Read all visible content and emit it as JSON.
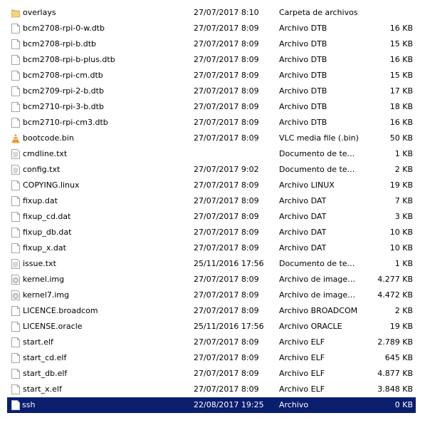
{
  "files": [
    {
      "name": "overlays",
      "date": "27/07/2017 8:10",
      "type": "Carpeta de archivos",
      "size": "",
      "icon": "folder-icon"
    },
    {
      "name": "bcm2708-rpi-0-w.dtb",
      "date": "27/07/2017 8:09",
      "type": "Archivo DTB",
      "size": "16 KB",
      "icon": "file-icon"
    },
    {
      "name": "bcm2708-rpi-b.dtb",
      "date": "27/07/2017 8:09",
      "type": "Archivo DTB",
      "size": "15 KB",
      "icon": "file-icon"
    },
    {
      "name": "bcm2708-rpi-b-plus.dtb",
      "date": "27/07/2017 8:09",
      "type": "Archivo DTB",
      "size": "16 KB",
      "icon": "file-icon"
    },
    {
      "name": "bcm2708-rpi-cm.dtb",
      "date": "27/07/2017 8:09",
      "type": "Archivo DTB",
      "size": "15 KB",
      "icon": "file-icon"
    },
    {
      "name": "bcm2709-rpi-2-b.dtb",
      "date": "27/07/2017 8:09",
      "type": "Archivo DTB",
      "size": "17 KB",
      "icon": "file-icon"
    },
    {
      "name": "bcm2710-rpi-3-b.dtb",
      "date": "27/07/2017 8:09",
      "type": "Archivo DTB",
      "size": "18 KB",
      "icon": "file-icon"
    },
    {
      "name": "bcm2710-rpi-cm3.dtb",
      "date": "27/07/2017 8:09",
      "type": "Archivo DTB",
      "size": "16 KB",
      "icon": "file-icon"
    },
    {
      "name": "bootcode.bin",
      "date": "27/07/2017 8:09",
      "type": "VLC media file (.bin)",
      "size": "50 KB",
      "icon": "vlc-icon"
    },
    {
      "name": "cmdline.txt",
      "date": "",
      "type": "Documento de texto",
      "size": "1 KB",
      "icon": "text-file-icon"
    },
    {
      "name": "config.txt",
      "date": "27/07/2017 9:02",
      "type": "Documento de texto",
      "size": "2 KB",
      "icon": "text-file-icon"
    },
    {
      "name": "COPYING.linux",
      "date": "27/07/2017 8:09",
      "type": "Archivo LINUX",
      "size": "19 KB",
      "icon": "file-icon"
    },
    {
      "name": "fixup.dat",
      "date": "27/07/2017 8:09",
      "type": "Archivo DAT",
      "size": "7 KB",
      "icon": "file-icon"
    },
    {
      "name": "fixup_cd.dat",
      "date": "27/07/2017 8:09",
      "type": "Archivo DAT",
      "size": "3 KB",
      "icon": "file-icon"
    },
    {
      "name": "fixup_db.dat",
      "date": "27/07/2017 8:09",
      "type": "Archivo DAT",
      "size": "10 KB",
      "icon": "file-icon"
    },
    {
      "name": "fixup_x.dat",
      "date": "27/07/2017 8:09",
      "type": "Archivo DAT",
      "size": "10 KB",
      "icon": "file-icon"
    },
    {
      "name": "issue.txt",
      "date": "25/11/2016 17:56",
      "type": "Documento de texto",
      "size": "1 KB",
      "icon": "text-file-icon"
    },
    {
      "name": "kernel.img",
      "date": "27/07/2017 8:09",
      "type": "Archivo de imagen ...",
      "size": "4.277 KB",
      "icon": "disc-image-icon"
    },
    {
      "name": "kernel7.img",
      "date": "27/07/2017 8:09",
      "type": "Archivo de imagen ...",
      "size": "4.472 KB",
      "icon": "disc-image-icon"
    },
    {
      "name": "LICENCE.broadcom",
      "date": "27/07/2017 8:09",
      "type": "Archivo BROADCOM",
      "size": "2 KB",
      "icon": "file-icon"
    },
    {
      "name": "LICENSE.oracle",
      "date": "25/11/2016 17:56",
      "type": "Archivo ORACLE",
      "size": "19 KB",
      "icon": "file-icon"
    },
    {
      "name": "start.elf",
      "date": "27/07/2017 8:09",
      "type": "Archivo ELF",
      "size": "2.789 KB",
      "icon": "file-icon"
    },
    {
      "name": "start_cd.elf",
      "date": "27/07/2017 8:09",
      "type": "Archivo ELF",
      "size": "645 KB",
      "icon": "file-icon"
    },
    {
      "name": "start_db.elf",
      "date": "27/07/2017 8:09",
      "type": "Archivo ELF",
      "size": "4.877 KB",
      "icon": "file-icon"
    },
    {
      "name": "start_x.elf",
      "date": "27/07/2017 8:09",
      "type": "Archivo ELF",
      "size": "3.848 KB",
      "icon": "file-icon"
    },
    {
      "name": "ssh",
      "date": "22/08/2017 19:25",
      "type": "Archivo",
      "size": "0 KB",
      "icon": "file-icon",
      "selected": true
    }
  ],
  "colors": {
    "selection": "#0b1e6e",
    "folder": "#e8c15a",
    "vlc": "#f08c1a"
  }
}
